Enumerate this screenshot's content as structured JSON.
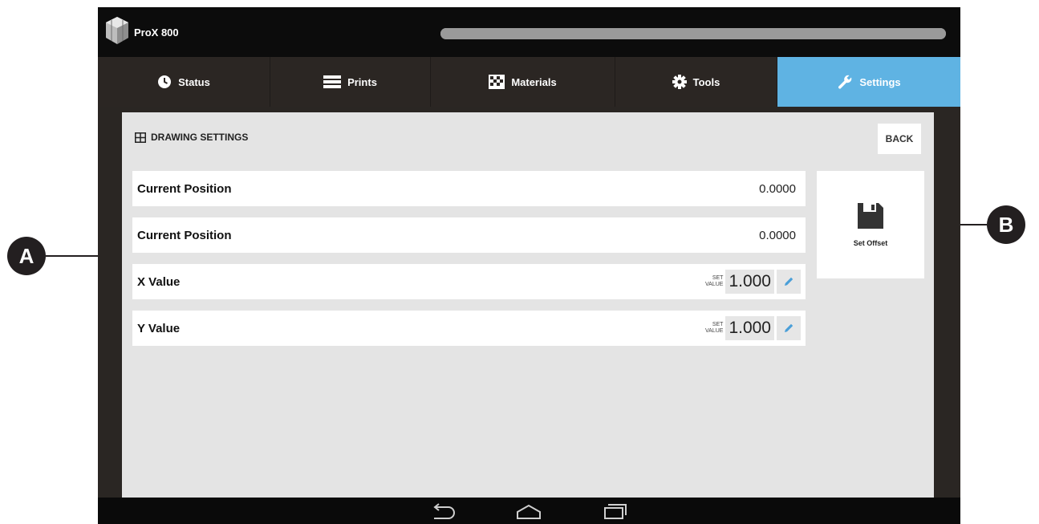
{
  "app": {
    "title": "ProX 800",
    "progress": 1.0
  },
  "tabs": [
    {
      "label": "Status",
      "icon": "clock-icon",
      "active": false
    },
    {
      "label": "Prints",
      "icon": "list-icon",
      "active": false
    },
    {
      "label": "Materials",
      "icon": "checker-icon",
      "active": false
    },
    {
      "label": "Tools",
      "icon": "gear-icon",
      "active": false
    },
    {
      "label": "Settings",
      "icon": "wrench-icon",
      "active": true
    }
  ],
  "panel": {
    "title": "DRAWING SETTINGS",
    "back_label": "BACK",
    "rows": [
      {
        "label": "Current Position",
        "value": "0.0000"
      },
      {
        "label": "Current Position",
        "value": "0.0000"
      },
      {
        "label": "X Value",
        "set_caption_1": "SET",
        "set_caption_2": "VALUE",
        "value": "1.000"
      },
      {
        "label": "Y Value",
        "set_caption_1": "SET",
        "set_caption_2": "VALUE",
        "value": "1.000"
      }
    ],
    "offset_button": {
      "label": "Set Offset",
      "icon": "floppy-disk-icon"
    }
  },
  "callouts": {
    "a": "A",
    "b": "B"
  },
  "colors": {
    "accent": "#5fb3e3",
    "tab_bar": "#2b2623",
    "panel_bg": "#e4e4e4",
    "topbar": "#0c0c0c"
  }
}
